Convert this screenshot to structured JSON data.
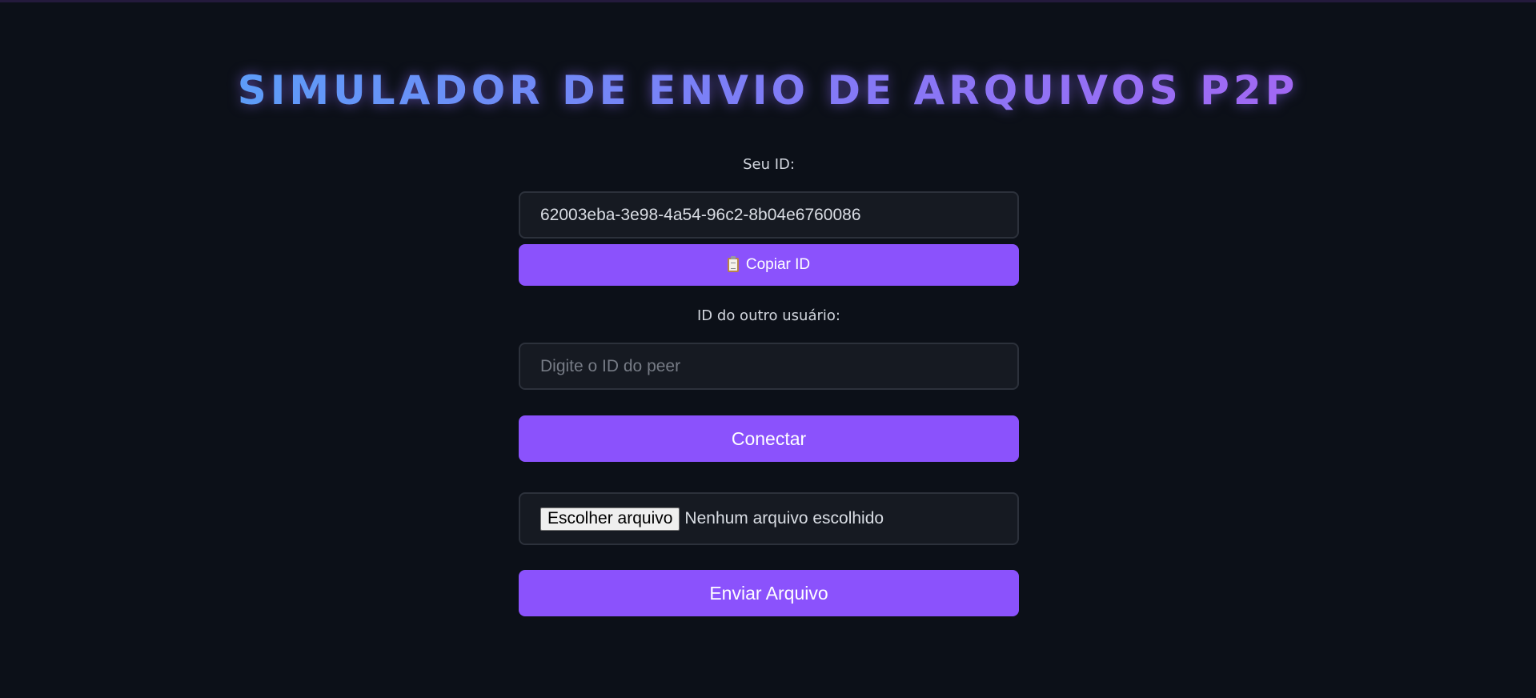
{
  "header": {
    "title": "SIMULADOR DE ENVIO DE ARQUIVOS P2P"
  },
  "my_id": {
    "label": "Seu ID:",
    "value": "62003eba-3e98-4a54-96c2-8b04e6760086",
    "copy_button": {
      "icon": "clipboard-icon",
      "label": "Copiar ID"
    }
  },
  "peer": {
    "label": "ID do outro usuário:",
    "placeholder": "Digite o ID do peer",
    "value": "",
    "connect_label": "Conectar"
  },
  "file": {
    "choose_label": "Escolher arquivo",
    "status": "Nenhum arquivo escolhido",
    "send_label": "Enviar Arquivo"
  },
  "colors": {
    "background": "#0c1018",
    "accent": "#8b52fc",
    "field_bg": "#161a22",
    "title_gradient_start": "#5d9cf8",
    "title_gradient_end": "#a268f4"
  }
}
